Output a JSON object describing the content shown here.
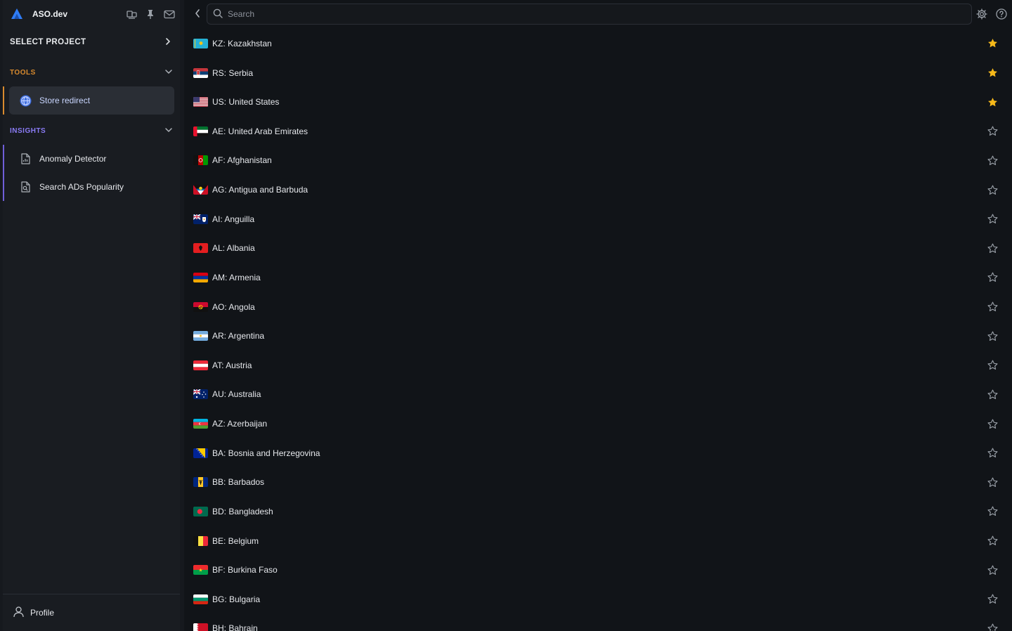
{
  "app": {
    "name": "ASO.dev",
    "logo_icon": "aso-logo-icon",
    "header_icons": [
      "mirror-icon",
      "pin-icon",
      "mail-icon"
    ]
  },
  "sidebar": {
    "select_project_label": "SELECT PROJECT",
    "sections": [
      {
        "title": "TOOLS",
        "color": "#d98b2e",
        "items": [
          {
            "label": "Store redirect",
            "icon": "globe-icon",
            "active": true
          }
        ]
      },
      {
        "title": "INSIGHTS",
        "color": "#8b7cf6",
        "items": [
          {
            "label": "Anomaly Detector",
            "icon": "document-chart-icon",
            "active": false
          },
          {
            "label": "Search ADs Popularity",
            "icon": "document-search-icon",
            "active": false
          }
        ]
      }
    ],
    "profile_label": "Profile"
  },
  "search": {
    "placeholder": "Search",
    "value": ""
  },
  "colors": {
    "star_active": "#f6b91a",
    "star_inactive": "#9aa0a8",
    "background": "#111418"
  },
  "countries": [
    {
      "label": "KZ: Kazakhstan",
      "code": "KZ",
      "starred": true
    },
    {
      "label": "RS: Serbia",
      "code": "RS",
      "starred": true
    },
    {
      "label": "US: United States",
      "code": "US",
      "starred": true
    },
    {
      "label": "AE: United Arab Emirates",
      "code": "AE",
      "starred": false
    },
    {
      "label": "AF: Afghanistan",
      "code": "AF",
      "starred": false
    },
    {
      "label": "AG: Antigua and Barbuda",
      "code": "AG",
      "starred": false
    },
    {
      "label": "AI: Anguilla",
      "code": "AI",
      "starred": false
    },
    {
      "label": "AL: Albania",
      "code": "AL",
      "starred": false
    },
    {
      "label": "AM: Armenia",
      "code": "AM",
      "starred": false
    },
    {
      "label": "AO: Angola",
      "code": "AO",
      "starred": false
    },
    {
      "label": "AR: Argentina",
      "code": "AR",
      "starred": false
    },
    {
      "label": "AT: Austria",
      "code": "AT",
      "starred": false
    },
    {
      "label": "AU: Australia",
      "code": "AU",
      "starred": false
    },
    {
      "label": "AZ: Azerbaijan",
      "code": "AZ",
      "starred": false
    },
    {
      "label": "BA: Bosnia and Herzegovina",
      "code": "BA",
      "starred": false
    },
    {
      "label": "BB: Barbados",
      "code": "BB",
      "starred": false
    },
    {
      "label": "BD: Bangladesh",
      "code": "BD",
      "starred": false
    },
    {
      "label": "BE: Belgium",
      "code": "BE",
      "starred": false
    },
    {
      "label": "BF: Burkina Faso",
      "code": "BF",
      "starred": false
    },
    {
      "label": "BG: Bulgaria",
      "code": "BG",
      "starred": false
    },
    {
      "label": "BH: Bahrain",
      "code": "BH",
      "starred": false
    }
  ]
}
